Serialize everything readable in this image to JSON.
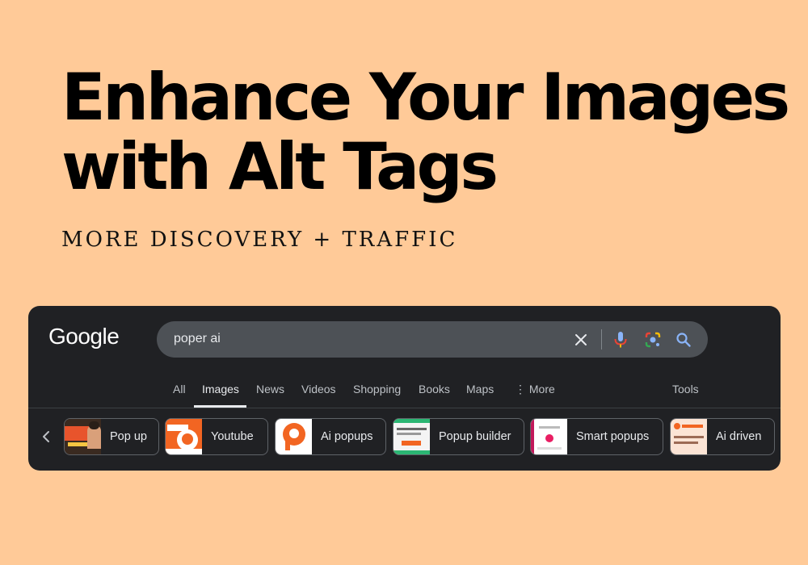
{
  "headline": {
    "line1": "Enhance Your Images",
    "line2": "with Alt Tags"
  },
  "subheadline": "MORE DISCOVERY + TRAFFIC",
  "search": {
    "logo": "Google",
    "query": "poper ai",
    "icons": [
      "close-icon",
      "microphone-icon",
      "lens-icon",
      "search-icon"
    ]
  },
  "tabs": [
    {
      "label": "All"
    },
    {
      "label": "Images",
      "active": true
    },
    {
      "label": "News"
    },
    {
      "label": "Videos"
    },
    {
      "label": "Shopping"
    },
    {
      "label": "Books"
    },
    {
      "label": "Maps"
    },
    {
      "label": "⋮ More"
    },
    {
      "label": "Tools"
    }
  ],
  "chips": [
    {
      "label": "Pop up"
    },
    {
      "label": "Youtube"
    },
    {
      "label": "Ai popups"
    },
    {
      "label": "Popup builder"
    },
    {
      "label": "Smart popups"
    },
    {
      "label": "Ai driven"
    }
  ],
  "colors": {
    "page_background": "#ffca98",
    "panel_background": "#202124",
    "search_box": "#4d5156",
    "text_light": "#e8eaed",
    "google_blue": "#8ab4f8",
    "google_red": "#ea4335",
    "google_yellow": "#fbbc05",
    "google_green": "#34a853",
    "poper_orange": "#f26522"
  }
}
